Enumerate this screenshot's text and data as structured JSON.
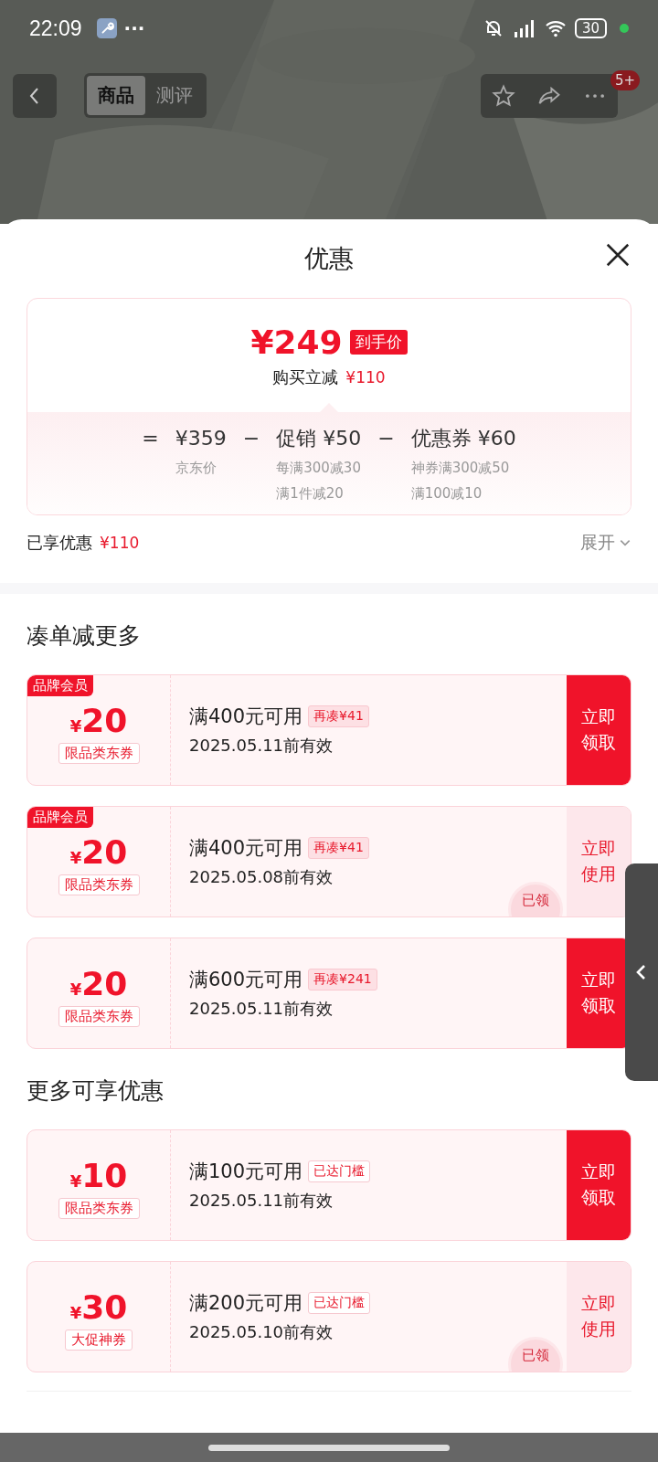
{
  "status_bar": {
    "time": "22:09",
    "more": "···",
    "battery": "30"
  },
  "nav": {
    "tabs": [
      {
        "label": "商品",
        "selected": true
      },
      {
        "label": "测评",
        "selected": false
      }
    ],
    "badge": "5+"
  },
  "sheet": {
    "title": "优惠"
  },
  "price_card": {
    "final_price": "¥249",
    "price_tag": "到手价",
    "saving_label": "购买立减",
    "saving_amount": "¥110",
    "breakdown": [
      {
        "operator": "=",
        "amount": "¥359",
        "notes": [
          "京东价"
        ]
      },
      {
        "operator": "−",
        "amount": "促销 ¥50",
        "notes": [
          "每满300减30",
          "满1件减20"
        ]
      },
      {
        "operator": "−",
        "amount": "优惠券 ¥60",
        "notes": [
          "神券满300减50",
          "满100减10"
        ]
      }
    ]
  },
  "summary": {
    "label": "已享优惠",
    "amount": "¥110",
    "expand": "展开"
  },
  "sections": [
    {
      "title": "凑单减更多",
      "coupons": [
        {
          "badge": "品牌会员",
          "currency": "¥",
          "amount": "20",
          "scope": "限品类东券",
          "condition": "满400元可用",
          "tag": {
            "kind": "gap",
            "text": "再凑¥41"
          },
          "validity": "2025.05.11前有效",
          "action": "立即领取",
          "claimed": false
        },
        {
          "badge": "品牌会员",
          "currency": "¥",
          "amount": "20",
          "scope": "限品类东券",
          "condition": "满400元可用",
          "tag": {
            "kind": "gap",
            "text": "再凑¥41"
          },
          "validity": "2025.05.08前有效",
          "action": "立即使用",
          "claimed": true,
          "stamp": "已领"
        },
        {
          "currency": "¥",
          "amount": "20",
          "scope": "限品类东券",
          "condition": "满600元可用",
          "tag": {
            "kind": "gap",
            "text": "再凑¥241"
          },
          "validity": "2025.05.11前有效",
          "action": "立即领取",
          "claimed": false
        }
      ]
    },
    {
      "title": "更多可享优惠",
      "coupons": [
        {
          "currency": "¥",
          "amount": "10",
          "scope": "限品类东券",
          "condition": "满100元可用",
          "tag": {
            "kind": "reached",
            "text": "已达门槛"
          },
          "validity": "2025.05.11前有效",
          "action": "立即领取",
          "claimed": false
        },
        {
          "currency": "¥",
          "amount": "30",
          "scope": "大促神券",
          "condition": "满200元可用",
          "tag": {
            "kind": "reached",
            "text": "已达门槛"
          },
          "validity": "2025.05.10前有效",
          "action": "立即使用",
          "claimed": true,
          "stamp": "已领"
        }
      ]
    }
  ]
}
